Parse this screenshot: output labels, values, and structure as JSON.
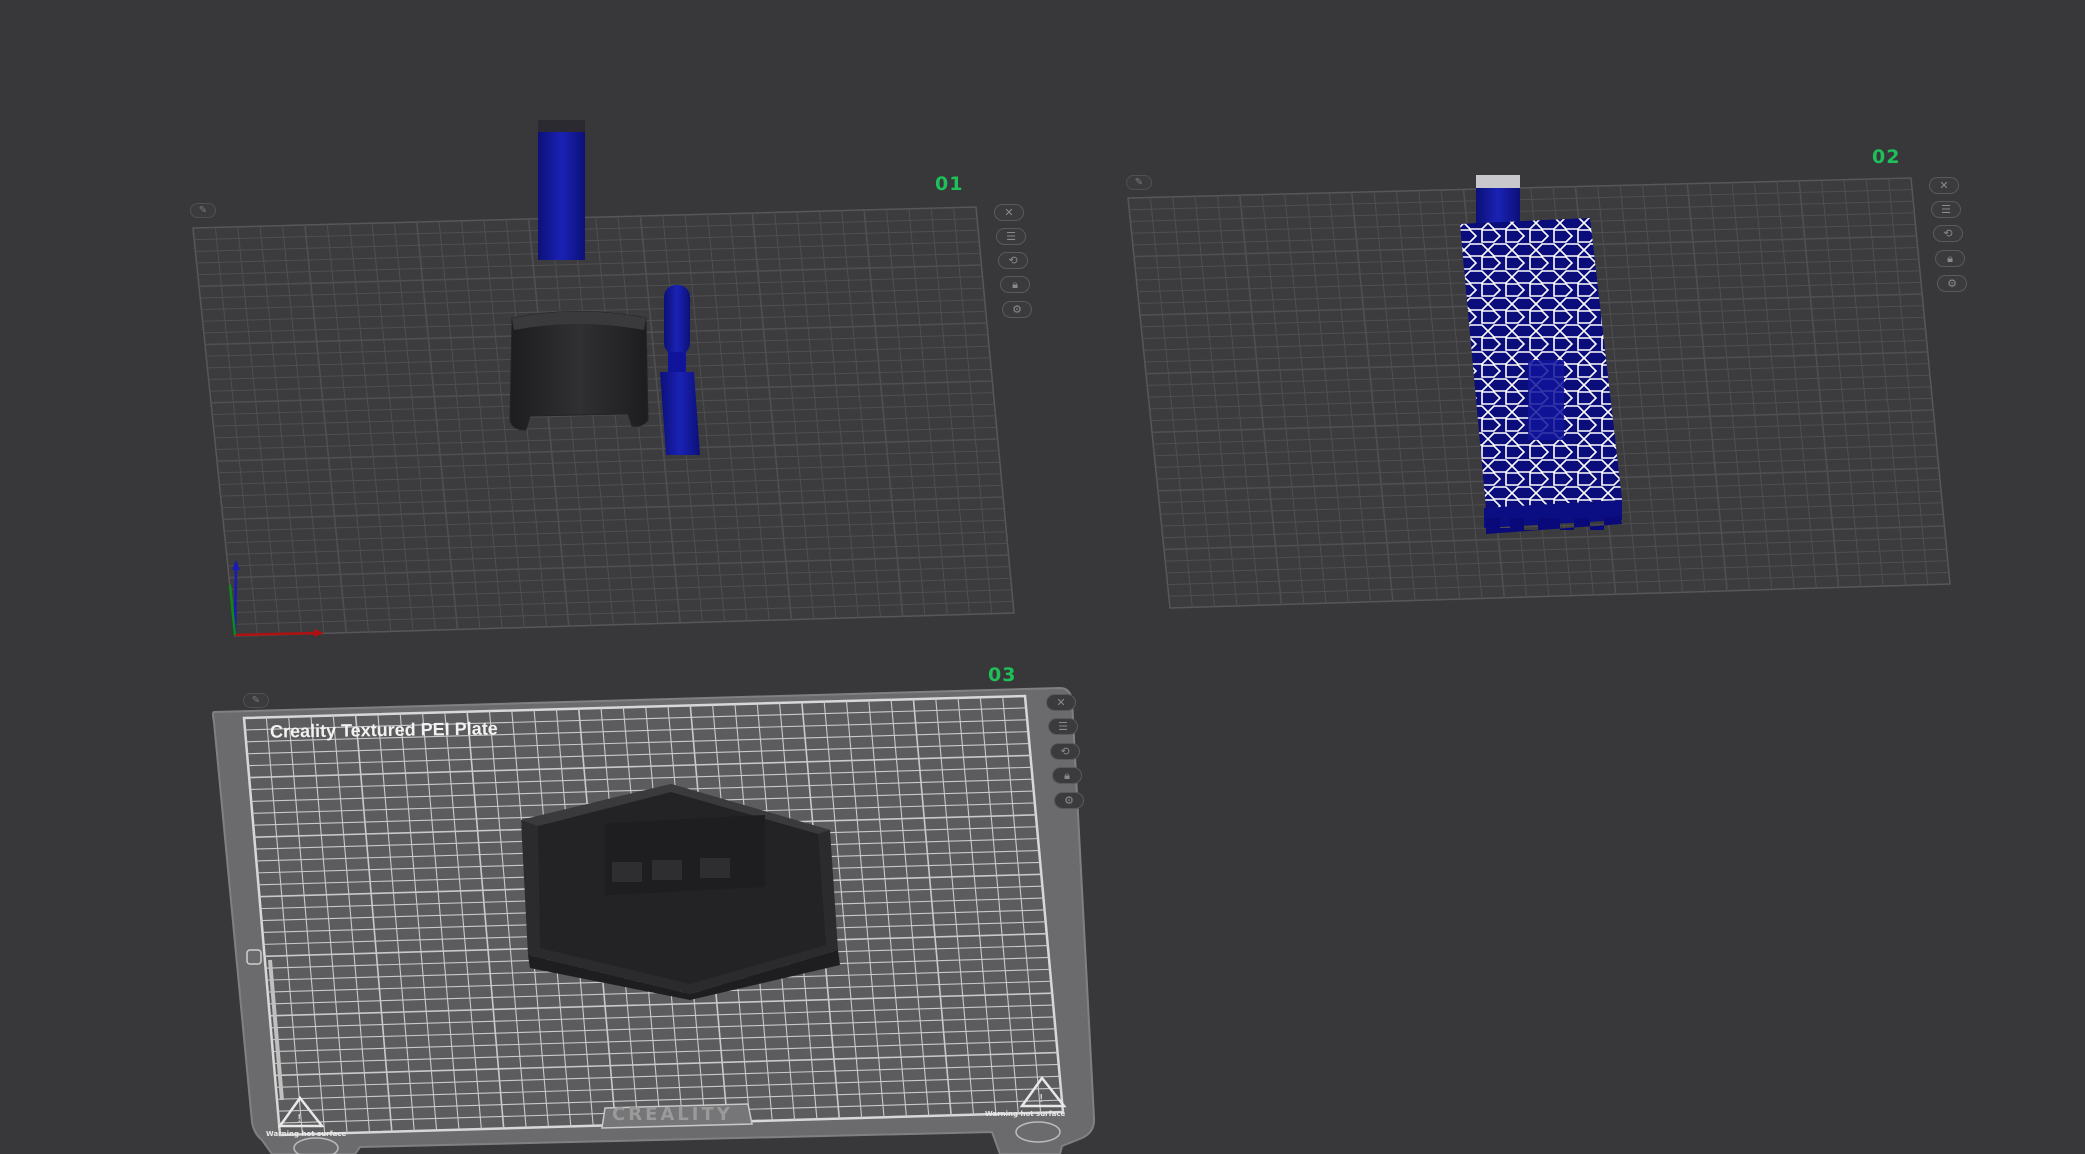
{
  "plates": [
    {
      "label": "01",
      "buttons": [
        "close-icon",
        "arrange-icon",
        "orient-icon",
        "lock-icon",
        "settings-icon"
      ]
    },
    {
      "label": "02",
      "buttons": [
        "close-icon",
        "arrange-icon",
        "orient-icon",
        "lock-icon",
        "settings-icon"
      ]
    },
    {
      "label": "03",
      "buttons": [
        "close-icon",
        "arrange-icon",
        "orient-icon",
        "lock-icon",
        "settings-icon"
      ]
    }
  ],
  "bed": {
    "title": "Creality Textured PEI Plate",
    "brand": "CREALITY",
    "warning_left": "Warning hot surface",
    "warning_right": "Warning hot surface"
  },
  "colors": {
    "background": "#38383a",
    "plate_label": "#1fbf5a",
    "model_blue": "#10149a",
    "model_dark": "#2a2a2a"
  }
}
